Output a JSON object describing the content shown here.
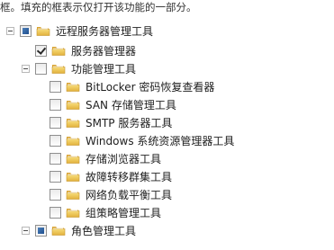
{
  "hint_text": "框。填充的框表示仅打开该功能的一部分。",
  "tree": {
    "remote_admin": {
      "label": "远程服务器管理工具"
    },
    "server_manager": {
      "label": "服务器管理器"
    },
    "feature_admin": {
      "label": "功能管理工具"
    },
    "features": [
      {
        "label": "BitLocker 密码恢复查看器"
      },
      {
        "label": "SAN 存储管理工具"
      },
      {
        "label": "SMTP 服务器工具"
      },
      {
        "label": "Windows 系统资源管理器工具"
      },
      {
        "label": "存储浏览器工具"
      },
      {
        "label": "故障转移群集工具"
      },
      {
        "label": "网络负载平衡工具"
      },
      {
        "label": "组策略管理工具"
      }
    ],
    "role_admin": {
      "label": "角色管理工具"
    }
  }
}
